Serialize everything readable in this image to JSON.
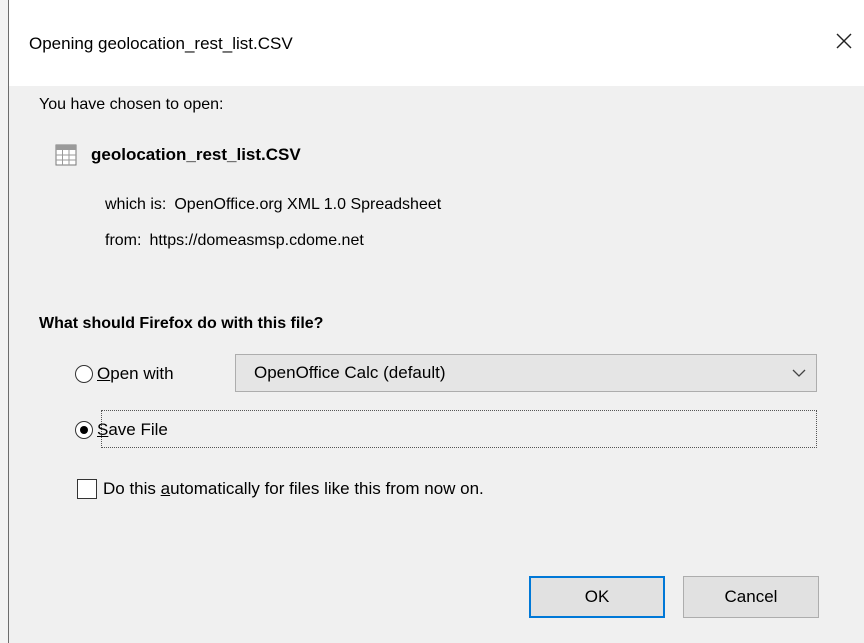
{
  "dialog": {
    "title": "Opening geolocation_rest_list.CSV"
  },
  "intro": {
    "label": "You have chosen to open:"
  },
  "file": {
    "name": "geolocation_rest_list.CSV",
    "icon": "spreadsheet-file-icon",
    "type_label": "which is:",
    "type_value": "OpenOffice.org XML 1.0 Spreadsheet",
    "from_label": "from:",
    "from_value": "https://domeasmsp.cdome.net"
  },
  "question": "What should Firefox do with this file?",
  "options": {
    "open_with": {
      "access_key": "O",
      "rest": "pen with",
      "selected": false
    },
    "app_select": {
      "value": "OpenOffice Calc (default)"
    },
    "save_file": {
      "access_key": "S",
      "rest": "ave File",
      "selected": true
    }
  },
  "auto": {
    "before": "Do this ",
    "access_key": "a",
    "after": "utomatically for files like this from now on.",
    "checked": false
  },
  "buttons": {
    "ok": "OK",
    "cancel": "Cancel"
  }
}
